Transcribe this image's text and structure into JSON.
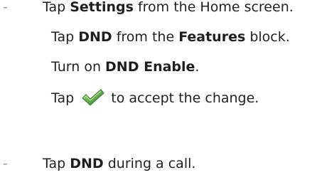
{
  "bullet_symbol": "-",
  "item1": {
    "prefix": "Tap ",
    "bold": "Settings",
    "suffix": " from the Home screen."
  },
  "steps": [
    {
      "prefix": "Tap ",
      "bold1": "DND",
      "middle": " from the ",
      "bold2": "Features",
      "suffix": " block."
    },
    {
      "prefix": "Turn on ",
      "bold": "DND Enable",
      "suffix": "."
    },
    {
      "prefix": "Tap ",
      "icon": "checkmark-icon",
      "suffix": " to accept the change."
    }
  ],
  "item2": {
    "prefix": "Tap ",
    "bold": "DND",
    "suffix": " during a call."
  },
  "colors": {
    "text": "#1f1f1f",
    "bullet": "#9a9a9a",
    "check_green": "#2e7d32",
    "check_light": "#8bc34a"
  }
}
